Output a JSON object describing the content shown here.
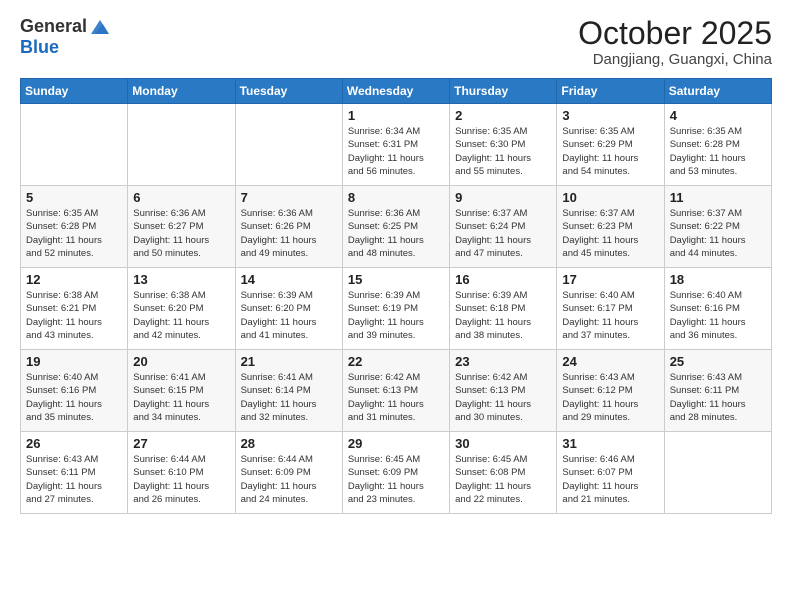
{
  "header": {
    "logo_general": "General",
    "logo_blue": "Blue",
    "month_title": "October 2025",
    "location": "Dangjiang, Guangxi, China"
  },
  "weekdays": [
    "Sunday",
    "Monday",
    "Tuesday",
    "Wednesday",
    "Thursday",
    "Friday",
    "Saturday"
  ],
  "weeks": [
    [
      {
        "day": "",
        "info": ""
      },
      {
        "day": "",
        "info": ""
      },
      {
        "day": "",
        "info": ""
      },
      {
        "day": "1",
        "info": "Sunrise: 6:34 AM\nSunset: 6:31 PM\nDaylight: 11 hours\nand 56 minutes."
      },
      {
        "day": "2",
        "info": "Sunrise: 6:35 AM\nSunset: 6:30 PM\nDaylight: 11 hours\nand 55 minutes."
      },
      {
        "day": "3",
        "info": "Sunrise: 6:35 AM\nSunset: 6:29 PM\nDaylight: 11 hours\nand 54 minutes."
      },
      {
        "day": "4",
        "info": "Sunrise: 6:35 AM\nSunset: 6:28 PM\nDaylight: 11 hours\nand 53 minutes."
      }
    ],
    [
      {
        "day": "5",
        "info": "Sunrise: 6:35 AM\nSunset: 6:28 PM\nDaylight: 11 hours\nand 52 minutes."
      },
      {
        "day": "6",
        "info": "Sunrise: 6:36 AM\nSunset: 6:27 PM\nDaylight: 11 hours\nand 50 minutes."
      },
      {
        "day": "7",
        "info": "Sunrise: 6:36 AM\nSunset: 6:26 PM\nDaylight: 11 hours\nand 49 minutes."
      },
      {
        "day": "8",
        "info": "Sunrise: 6:36 AM\nSunset: 6:25 PM\nDaylight: 11 hours\nand 48 minutes."
      },
      {
        "day": "9",
        "info": "Sunrise: 6:37 AM\nSunset: 6:24 PM\nDaylight: 11 hours\nand 47 minutes."
      },
      {
        "day": "10",
        "info": "Sunrise: 6:37 AM\nSunset: 6:23 PM\nDaylight: 11 hours\nand 45 minutes."
      },
      {
        "day": "11",
        "info": "Sunrise: 6:37 AM\nSunset: 6:22 PM\nDaylight: 11 hours\nand 44 minutes."
      }
    ],
    [
      {
        "day": "12",
        "info": "Sunrise: 6:38 AM\nSunset: 6:21 PM\nDaylight: 11 hours\nand 43 minutes."
      },
      {
        "day": "13",
        "info": "Sunrise: 6:38 AM\nSunset: 6:20 PM\nDaylight: 11 hours\nand 42 minutes."
      },
      {
        "day": "14",
        "info": "Sunrise: 6:39 AM\nSunset: 6:20 PM\nDaylight: 11 hours\nand 41 minutes."
      },
      {
        "day": "15",
        "info": "Sunrise: 6:39 AM\nSunset: 6:19 PM\nDaylight: 11 hours\nand 39 minutes."
      },
      {
        "day": "16",
        "info": "Sunrise: 6:39 AM\nSunset: 6:18 PM\nDaylight: 11 hours\nand 38 minutes."
      },
      {
        "day": "17",
        "info": "Sunrise: 6:40 AM\nSunset: 6:17 PM\nDaylight: 11 hours\nand 37 minutes."
      },
      {
        "day": "18",
        "info": "Sunrise: 6:40 AM\nSunset: 6:16 PM\nDaylight: 11 hours\nand 36 minutes."
      }
    ],
    [
      {
        "day": "19",
        "info": "Sunrise: 6:40 AM\nSunset: 6:16 PM\nDaylight: 11 hours\nand 35 minutes."
      },
      {
        "day": "20",
        "info": "Sunrise: 6:41 AM\nSunset: 6:15 PM\nDaylight: 11 hours\nand 34 minutes."
      },
      {
        "day": "21",
        "info": "Sunrise: 6:41 AM\nSunset: 6:14 PM\nDaylight: 11 hours\nand 32 minutes."
      },
      {
        "day": "22",
        "info": "Sunrise: 6:42 AM\nSunset: 6:13 PM\nDaylight: 11 hours\nand 31 minutes."
      },
      {
        "day": "23",
        "info": "Sunrise: 6:42 AM\nSunset: 6:13 PM\nDaylight: 11 hours\nand 30 minutes."
      },
      {
        "day": "24",
        "info": "Sunrise: 6:43 AM\nSunset: 6:12 PM\nDaylight: 11 hours\nand 29 minutes."
      },
      {
        "day": "25",
        "info": "Sunrise: 6:43 AM\nSunset: 6:11 PM\nDaylight: 11 hours\nand 28 minutes."
      }
    ],
    [
      {
        "day": "26",
        "info": "Sunrise: 6:43 AM\nSunset: 6:11 PM\nDaylight: 11 hours\nand 27 minutes."
      },
      {
        "day": "27",
        "info": "Sunrise: 6:44 AM\nSunset: 6:10 PM\nDaylight: 11 hours\nand 26 minutes."
      },
      {
        "day": "28",
        "info": "Sunrise: 6:44 AM\nSunset: 6:09 PM\nDaylight: 11 hours\nand 24 minutes."
      },
      {
        "day": "29",
        "info": "Sunrise: 6:45 AM\nSunset: 6:09 PM\nDaylight: 11 hours\nand 23 minutes."
      },
      {
        "day": "30",
        "info": "Sunrise: 6:45 AM\nSunset: 6:08 PM\nDaylight: 11 hours\nand 22 minutes."
      },
      {
        "day": "31",
        "info": "Sunrise: 6:46 AM\nSunset: 6:07 PM\nDaylight: 11 hours\nand 21 minutes."
      },
      {
        "day": "",
        "info": ""
      }
    ]
  ]
}
